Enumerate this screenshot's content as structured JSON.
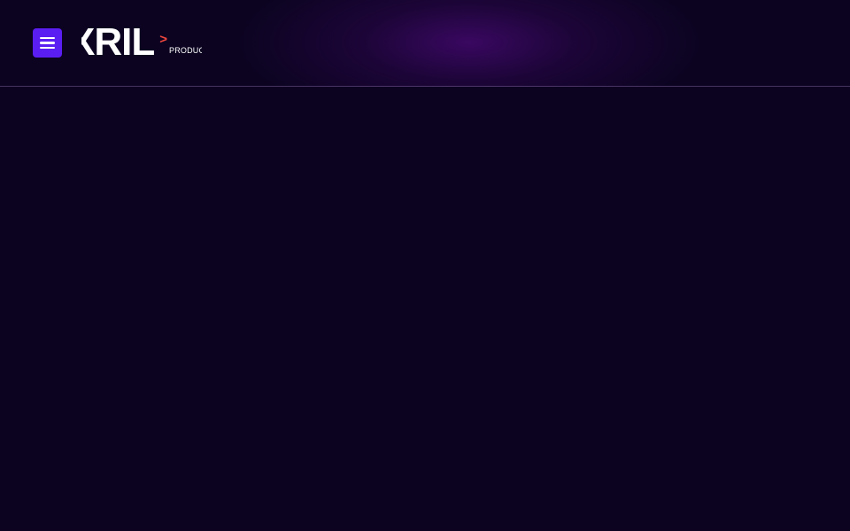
{
  "header": {
    "menu_icon": "hamburger-menu-icon",
    "logo": {
      "word": "XRIL",
      "chevron": ">",
      "tagline": "PRODUCTIONS"
    }
  },
  "colors": {
    "background": "#0c0321",
    "accent": "#5b1ef2",
    "logo_chevron": "#f2483e",
    "header_glow": "#3c0864"
  }
}
